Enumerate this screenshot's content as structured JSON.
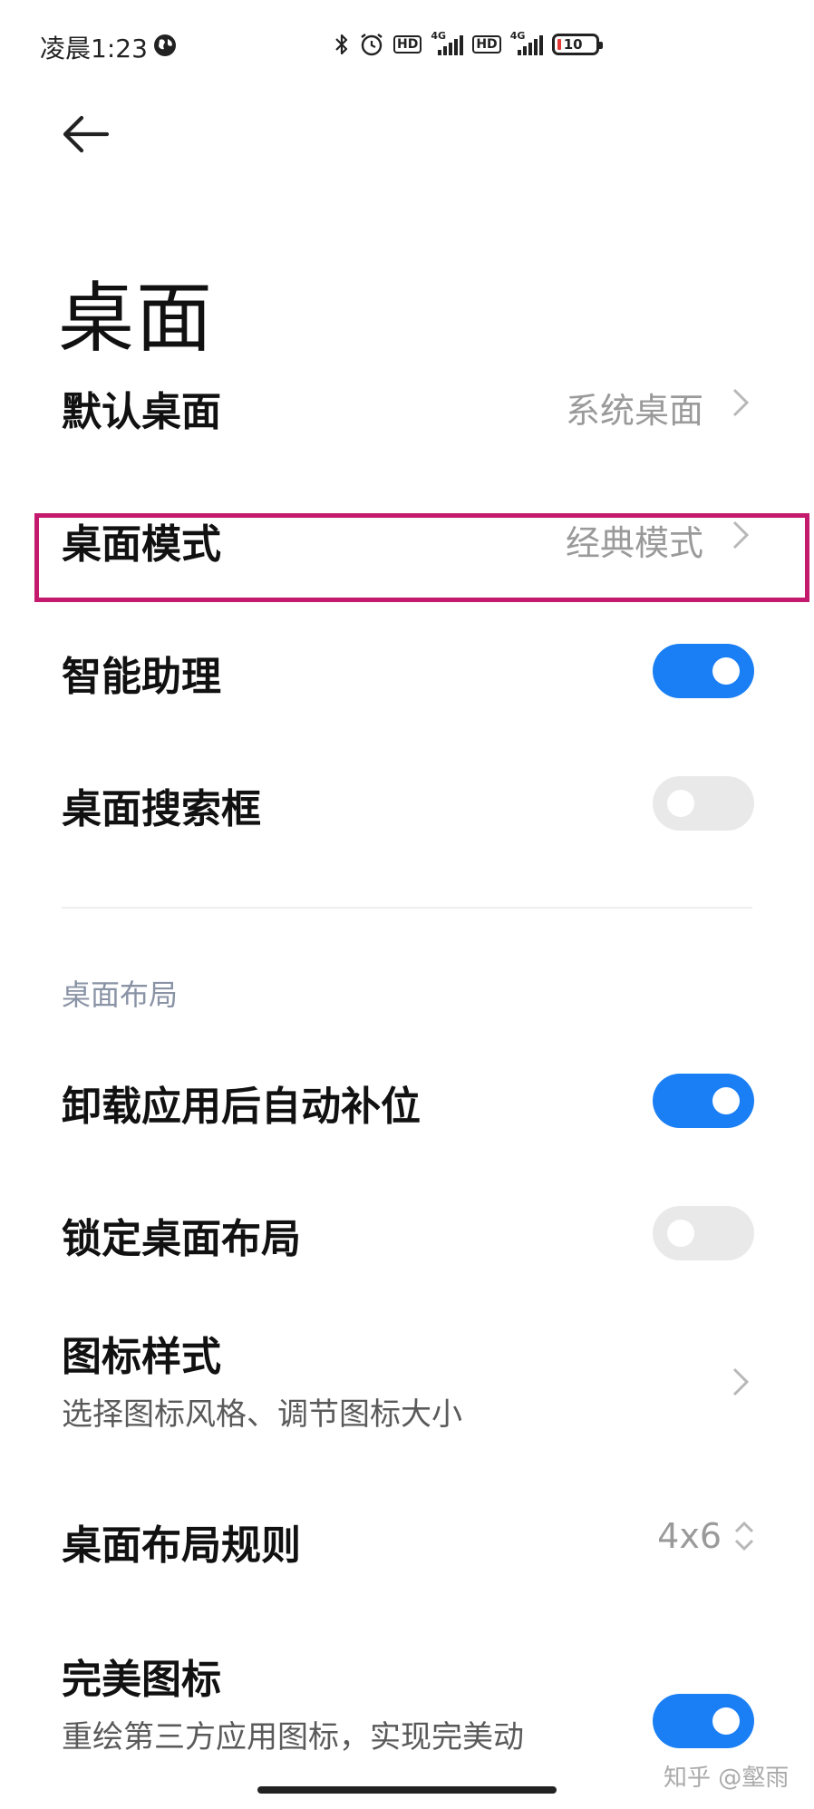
{
  "status_bar": {
    "time": "凌晨1:23",
    "icons": [
      "globe-icon",
      "bluetooth-icon",
      "alarm-icon",
      "hd-icon",
      "signal-4g-icon",
      "hd-icon",
      "signal-4g-icon",
      "battery-icon"
    ],
    "hd_label": "HD",
    "network_label": "4G",
    "battery_level": "10",
    "battery_color": "#e53935"
  },
  "header": {
    "title": "桌面"
  },
  "settings": {
    "default_desktop": {
      "label": "默认桌面",
      "value": "系统桌面"
    },
    "desktop_mode": {
      "label": "桌面模式",
      "value": "经典模式"
    },
    "smart_assistant": {
      "label": "智能助理",
      "enabled": true
    },
    "desktop_search_box": {
      "label": "桌面搜索框",
      "enabled": false
    }
  },
  "layout_section": {
    "header": "桌面布局",
    "auto_fill_after_uninstall": {
      "label": "卸载应用后自动补位",
      "enabled": true
    },
    "lock_layout": {
      "label": "锁定桌面布局",
      "enabled": false
    },
    "icon_style": {
      "label": "图标样式",
      "subtitle": "选择图标风格、调节图标大小"
    },
    "layout_rule": {
      "label": "桌面布局规则",
      "value": "4x6"
    },
    "perfect_icons": {
      "label": "完美图标",
      "subtitle": "重绘第三方应用图标，实现完美动",
      "enabled": true
    }
  },
  "watermark": "知乎 @壑雨",
  "colors": {
    "accent": "#1a7ff5",
    "highlight": "#c41a6e",
    "toggle_off": "#e9e9e9",
    "section_header": "#8a93a6"
  }
}
